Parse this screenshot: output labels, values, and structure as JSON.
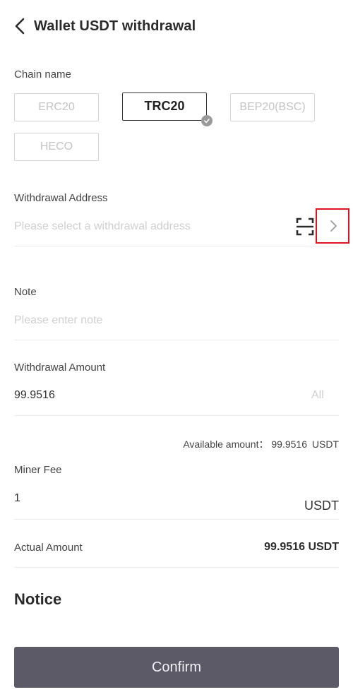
{
  "header": {
    "title": "Wallet USDT withdrawal",
    "back_icon": "chevron-left-icon"
  },
  "chain": {
    "label": "Chain name",
    "options": [
      "ERC20",
      "TRC20",
      "BEP20(BSC)",
      "HECO"
    ],
    "selected": "TRC20"
  },
  "address": {
    "label": "Withdrawal Address",
    "placeholder": "Please select a withdrawal address",
    "scan_icon": "scan-icon",
    "select_icon": "chevron-right-icon"
  },
  "note": {
    "label": "Note",
    "placeholder": "Please enter note"
  },
  "amount": {
    "label": "Withdrawal Amount",
    "value": "99.9516",
    "all_label": "All",
    "available_label": "Available amount：",
    "available_value": "99.9516",
    "available_unit": "USDT"
  },
  "fee": {
    "label": "Miner Fee",
    "value": "1",
    "unit": "USDT"
  },
  "actual": {
    "label": "Actual Amount",
    "value": "99.9516 USDT"
  },
  "notice": {
    "title": "Notice"
  },
  "confirm_label": "Confirm",
  "colors": {
    "highlight": "#e0141e",
    "button": "#5c5a66",
    "badge": "#9a9a9a"
  }
}
